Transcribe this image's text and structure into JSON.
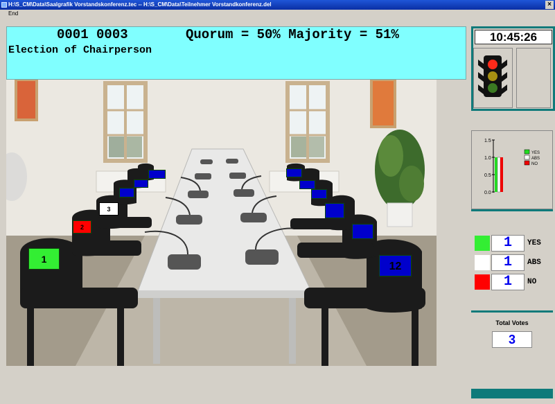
{
  "window": {
    "title": "H:\\S_CM\\Data\\Saalgrafik Vorstandskonferenz.tec -- H:\\S_CM\\Data\\Teilnehmer Vorstandkonferenz.del",
    "close_glyph": "×"
  },
  "menu": {
    "end_label": "End"
  },
  "header": {
    "ids": "0001 0003",
    "quorum": "Quorum = 50% Majority = 51%",
    "title": "Election of Chairperson"
  },
  "seats": [
    {
      "label": "1",
      "status": "green"
    },
    {
      "label": "2",
      "status": "red"
    },
    {
      "label": "3",
      "status": "white"
    },
    {
      "label": "",
      "status": "blue"
    },
    {
      "label": "",
      "status": "blue"
    },
    {
      "label": "",
      "status": "blue"
    },
    {
      "label": "",
      "status": "blue"
    },
    {
      "label": "",
      "status": "blue"
    },
    {
      "label": "",
      "status": "blue"
    },
    {
      "label": "",
      "status": "blue"
    },
    {
      "label": "",
      "status": "blue"
    },
    {
      "label": "12",
      "status": "blue"
    }
  ],
  "clock": "10:45:26",
  "traffic_light": {
    "icon": "traffic-light-icon",
    "active": "red"
  },
  "mini_chart": {
    "yticks": [
      "1.5",
      "1.0",
      "0.5",
      "0.0"
    ],
    "legend": [
      "YES",
      "ABS",
      "NO"
    ],
    "values": {
      "yes": 1,
      "abs": 1,
      "no": 1
    }
  },
  "results": {
    "yes": {
      "label": "YES",
      "count": "1",
      "color": "#33ee33"
    },
    "abs": {
      "label": "ABS",
      "count": "1",
      "color": "#ffffff"
    },
    "no": {
      "label": "NO",
      "count": "1",
      "color": "#ff0000"
    }
  },
  "total": {
    "label": "Total Votes",
    "value": "3"
  }
}
